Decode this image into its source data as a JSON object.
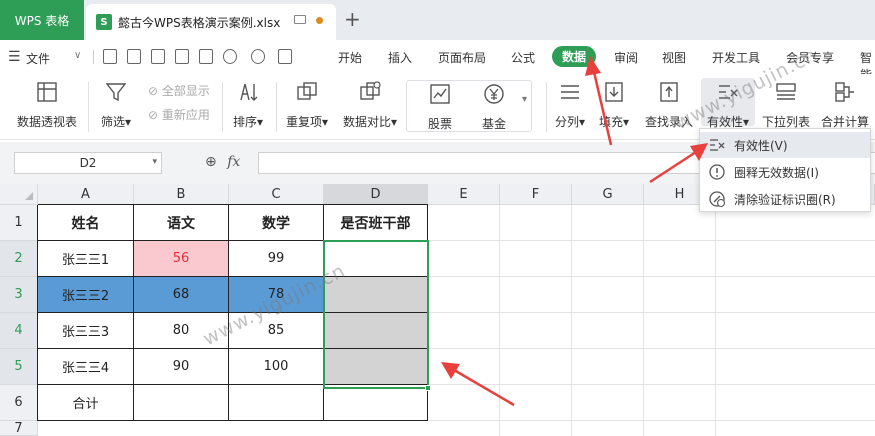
{
  "titlebar": {
    "app_tab": "WPS 表格",
    "doc_tab": "懿古今WPS表格演示案例.xlsx",
    "doc_icon": "S"
  },
  "menu": {
    "file": "文件",
    "tabs": [
      "开始",
      "插入",
      "页面布局",
      "公式",
      "数据",
      "审阅",
      "视图",
      "开发工具",
      "会员专享",
      "智能"
    ],
    "active_tab": "数据"
  },
  "ribbon": {
    "pivot": "数据透视表",
    "filter": "筛选",
    "show_all": "全部显示",
    "reapply": "重新应用",
    "sort": "排序",
    "duplicates": "重复项",
    "compare": "数据对比",
    "stock": "股票",
    "fund": "基金",
    "split": "分列",
    "fill": "填充",
    "lookup": "查找录入",
    "validity": "有效性",
    "dropdown_list": "下拉列表",
    "merge_calc": "合并计算"
  },
  "validity_menu": {
    "items": [
      "有效性(V)",
      "圈释无效数据(I)",
      "清除验证标识圈(R)"
    ]
  },
  "formula_bar": {
    "name_box": "D2",
    "fx": "fx",
    "content": ""
  },
  "sheet": {
    "columns": [
      "A",
      "B",
      "C",
      "D",
      "E",
      "F",
      "G",
      "H",
      "I"
    ],
    "row_numbers": [
      "1",
      "2",
      "3",
      "4",
      "5",
      "6",
      "7"
    ],
    "rows": [
      [
        "姓名",
        "语文",
        "数学",
        "是否班干部"
      ],
      [
        "张三三1",
        "56",
        "99",
        ""
      ],
      [
        "张三三2",
        "68",
        "78",
        ""
      ],
      [
        "张三三3",
        "80",
        "85",
        ""
      ],
      [
        "张三三4",
        "90",
        "100",
        ""
      ],
      [
        "合计",
        "",
        "",
        ""
      ],
      [
        "",
        "",
        "",
        ""
      ]
    ]
  },
  "watermark": "www.yigujin.cn",
  "colors": {
    "accent": "#2e9e56",
    "pink_cell": "#f9c9cf",
    "pink_text": "#e0303a",
    "blue_row": "#5b9bd5",
    "gray_fill": "#d3d3d3",
    "arrow": "#e8403c"
  }
}
